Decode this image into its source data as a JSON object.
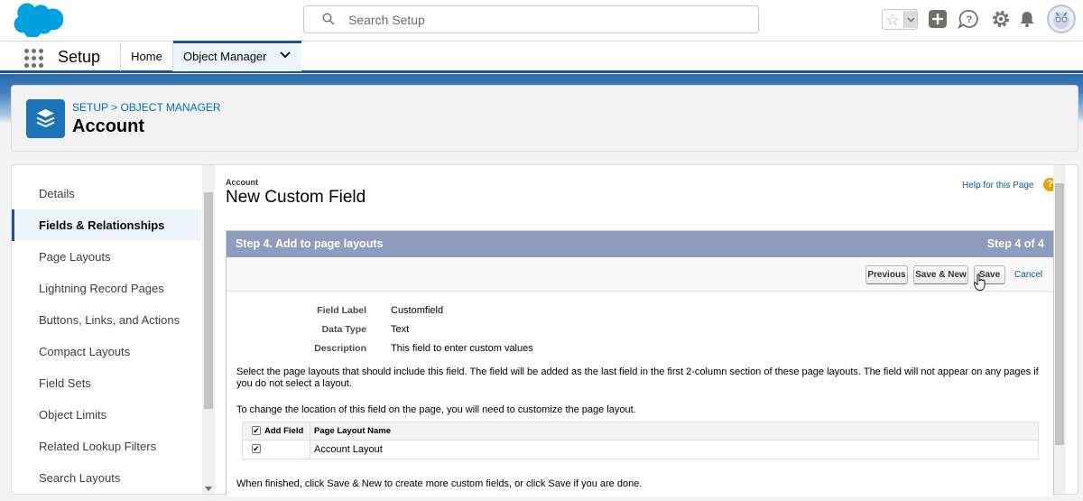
{
  "header": {
    "search_placeholder": "Search Setup"
  },
  "nav": {
    "app_name": "Setup",
    "tabs": [
      {
        "label": "Home"
      },
      {
        "label": "Object Manager"
      }
    ]
  },
  "page_header": {
    "breadcrumb": "SETUP > OBJECT MANAGER",
    "title": "Account"
  },
  "sidebar": {
    "items": [
      {
        "label": "Details"
      },
      {
        "label": "Fields & Relationships"
      },
      {
        "label": "Page Layouts"
      },
      {
        "label": "Lightning Record Pages"
      },
      {
        "label": "Buttons, Links, and Actions"
      },
      {
        "label": "Compact Layouts"
      },
      {
        "label": "Field Sets"
      },
      {
        "label": "Object Limits"
      },
      {
        "label": "Related Lookup Filters"
      },
      {
        "label": "Search Layouts"
      }
    ],
    "active_index": 1
  },
  "main": {
    "object": "Account",
    "title": "New Custom Field",
    "help_link": "Help for this Page",
    "help_icon": "?",
    "step_title": "Step 4. Add to page layouts",
    "step_count": "Step 4 of 4",
    "buttons": {
      "previous": "Previous",
      "save_new": "Save & New",
      "save": "Save",
      "cancel": "Cancel"
    },
    "fields": [
      {
        "label": "Field Label",
        "value": "Customfield"
      },
      {
        "label": "Data Type",
        "value": "Text"
      },
      {
        "label": "Description",
        "value": "This field to enter custom values"
      }
    ],
    "instructions": "Select the page layouts that should include this field. The field will be added as the last field in the first 2-column section of these page layouts. The field will not appear on any pages if you do not select a layout.",
    "location_note": "To change the location of this field on the page, you will need to customize the page layout.",
    "table": {
      "headers": [
        "Add Field",
        "Page Layout Name"
      ],
      "rows": [
        {
          "checked": true,
          "name": "Account Layout"
        }
      ]
    },
    "finish_note": "When finished, click Save & New to create more custom fields, or click Save if you are done."
  },
  "colors": {
    "brand": "#1b5297",
    "step_header": "#8e9dbe",
    "link": "#015ba7",
    "object_icon": "#1d73b7"
  }
}
